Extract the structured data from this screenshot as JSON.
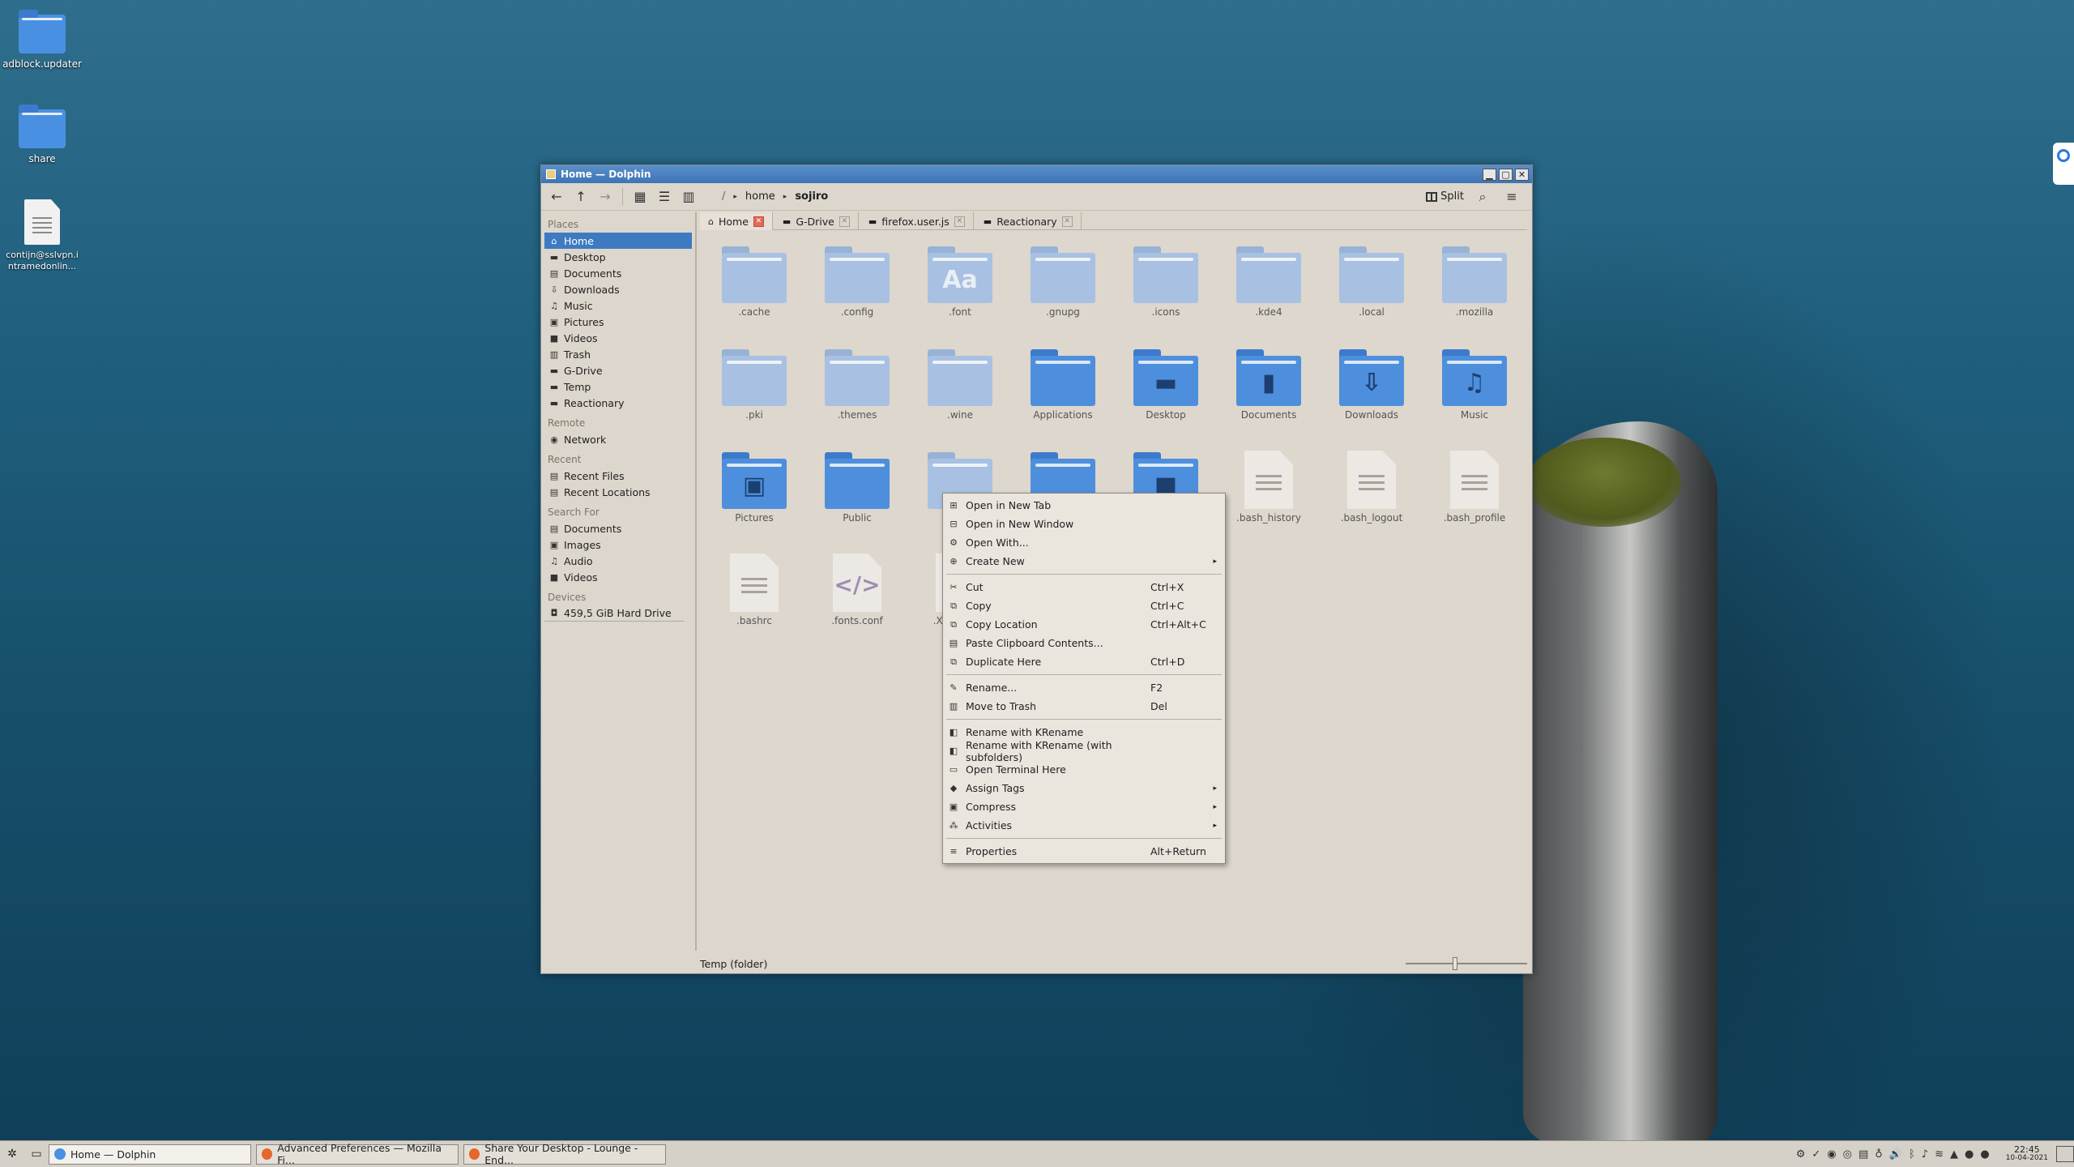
{
  "desktop": {
    "icons": [
      {
        "label": "adblock.updater",
        "type": "folder"
      },
      {
        "label": "share",
        "type": "folder"
      },
      {
        "label": "contijn@sslvpn.i ntramedonlin...",
        "type": "document"
      }
    ]
  },
  "window": {
    "title": "Home — Dolphin",
    "controls": {
      "minimize": "▁",
      "maximize": "▢",
      "close": "✕"
    }
  },
  "toolbar": {
    "back": "←",
    "up": "↑",
    "forward": "→",
    "view_icons": "▦",
    "view_compact": "☰",
    "view_details": "▥",
    "breadcrumb": {
      "root": "/",
      "parts": [
        "home",
        "sojiro"
      ]
    },
    "split_label": "Split",
    "search": "⌕",
    "menu": "≡"
  },
  "places": {
    "sections": [
      {
        "header": "Places",
        "items": [
          {
            "label": "Home",
            "icon": "⌂",
            "selected": true
          },
          {
            "label": "Desktop",
            "icon": "▬"
          },
          {
            "label": "Documents",
            "icon": "▤"
          },
          {
            "label": "Downloads",
            "icon": "⇩"
          },
          {
            "label": "Music",
            "icon": "♫"
          },
          {
            "label": "Pictures",
            "icon": "▣"
          },
          {
            "label": "Videos",
            "icon": "■"
          },
          {
            "label": "Trash",
            "icon": "▥"
          },
          {
            "label": "G-Drive",
            "icon": "▬"
          },
          {
            "label": "Temp",
            "icon": "▬"
          },
          {
            "label": "Reactionary",
            "icon": "▬"
          }
        ]
      },
      {
        "header": "Remote",
        "items": [
          {
            "label": "Network",
            "icon": "◉"
          }
        ]
      },
      {
        "header": "Recent",
        "items": [
          {
            "label": "Recent Files",
            "icon": "▤"
          },
          {
            "label": "Recent Locations",
            "icon": "▤"
          }
        ]
      },
      {
        "header": "Search For",
        "items": [
          {
            "label": "Documents",
            "icon": "▤"
          },
          {
            "label": "Images",
            "icon": "▣"
          },
          {
            "label": "Audio",
            "icon": "♫"
          },
          {
            "label": "Videos",
            "icon": "■"
          }
        ]
      },
      {
        "header": "Devices",
        "items": [
          {
            "label": "459,5 GiB Hard Drive",
            "icon": "◘"
          }
        ]
      }
    ]
  },
  "tabs": [
    {
      "label": "Home",
      "icon": "⌂",
      "active": true
    },
    {
      "label": "G-Drive",
      "icon": "▬"
    },
    {
      "label": "firefox.user.js",
      "icon": "▬"
    },
    {
      "label": "Reactionary",
      "icon": "▬"
    }
  ],
  "files": [
    {
      "name": ".cache",
      "kind": "hidden"
    },
    {
      "name": ".config",
      "kind": "hidden"
    },
    {
      "name": ".font",
      "kind": "hidden",
      "glyph": "Aa"
    },
    {
      "name": ".gnupg",
      "kind": "hidden"
    },
    {
      "name": ".icons",
      "kind": "hidden"
    },
    {
      "name": ".kde4",
      "kind": "hidden"
    },
    {
      "name": ".local",
      "kind": "hidden"
    },
    {
      "name": ".mozilla",
      "kind": "hidden"
    },
    {
      "name": ".pki",
      "kind": "hidden"
    },
    {
      "name": ".themes",
      "kind": "hidden"
    },
    {
      "name": ".wine",
      "kind": "hidden"
    },
    {
      "name": "Applications",
      "kind": "normal"
    },
    {
      "name": "Desktop",
      "kind": "normal",
      "glyph": "▬"
    },
    {
      "name": "Documents",
      "kind": "normal",
      "glyph": "▮"
    },
    {
      "name": "Downloads",
      "kind": "normal",
      "glyph": "⇩"
    },
    {
      "name": "Music",
      "kind": "normal",
      "glyph": "♫"
    },
    {
      "name": "Pictures",
      "kind": "normal",
      "glyph": "▣"
    },
    {
      "name": "Public",
      "kind": "normal"
    },
    {
      "name": "",
      "kind": "hidden"
    },
    {
      "name": "",
      "kind": "normal"
    },
    {
      "name": "",
      "kind": "normal",
      "glyph": "■"
    },
    {
      "name": ".bash_history",
      "kind": "doc"
    },
    {
      "name": ".bash_logout",
      "kind": "doc"
    },
    {
      "name": ".bash_profile",
      "kind": "doc"
    },
    {
      "name": ".bashrc",
      "kind": "doc"
    },
    {
      "name": ".fonts.conf",
      "kind": "code",
      "glyph": "</>"
    },
    {
      "name": ".Xauthority",
      "kind": "unknown",
      "glyph": "?"
    }
  ],
  "context_menu": {
    "items": [
      {
        "label": "Open in New Tab",
        "icon": "⊞"
      },
      {
        "label": "Open in New Window",
        "icon": "⊟"
      },
      {
        "label": "Open With...",
        "icon": "⚙"
      },
      {
        "label": "Create New",
        "icon": "⊕",
        "submenu": true
      },
      {
        "sep": true
      },
      {
        "label": "Cut",
        "icon": "✂",
        "shortcut": "Ctrl+X"
      },
      {
        "label": "Copy",
        "icon": "⧉",
        "shortcut": "Ctrl+C"
      },
      {
        "label": "Copy Location",
        "icon": "⧉",
        "shortcut": "Ctrl+Alt+C"
      },
      {
        "label": "Paste Clipboard Contents...",
        "icon": "▤"
      },
      {
        "label": "Duplicate Here",
        "icon": "⧉",
        "shortcut": "Ctrl+D"
      },
      {
        "sep": true
      },
      {
        "label": "Rename...",
        "icon": "✎",
        "shortcut": "F2"
      },
      {
        "label": "Move to Trash",
        "icon": "▥",
        "shortcut": "Del"
      },
      {
        "sep": true
      },
      {
        "label": "Rename with KRename",
        "icon": "◧"
      },
      {
        "label": "Rename with KRename (with subfolders)",
        "icon": "◧"
      },
      {
        "label": "Open Terminal Here",
        "icon": "▭"
      },
      {
        "label": "Assign Tags",
        "icon": "◆",
        "submenu": true
      },
      {
        "label": "Compress",
        "icon": "▣",
        "submenu": true
      },
      {
        "label": "Activities",
        "icon": "⁂",
        "submenu": true
      },
      {
        "sep": true
      },
      {
        "label": "Properties",
        "icon": "≡",
        "shortcut": "Alt+Return"
      }
    ],
    "submenu_arrow": "▸"
  },
  "statusbar": {
    "text": "Temp (folder)",
    "zoom": 0.4
  },
  "taskbar": {
    "tasks": [
      {
        "label": "Home — Dolphin",
        "color": "#4a90e2",
        "active": true
      },
      {
        "label": "Advanced Preferences — Mozilla Fi...",
        "color": "#e5672b"
      },
      {
        "label": "Share Your Desktop - Lounge - End...",
        "color": "#e5672b"
      }
    ],
    "tray_icons": [
      "⚙",
      "✓",
      "◉",
      "◎",
      "▤",
      "♁",
      "🔊",
      "ᛒ",
      "♪",
      "≋",
      "▲",
      "●",
      "●"
    ],
    "clock": {
      "time": "22:45",
      "date": "10-04-2021"
    }
  }
}
